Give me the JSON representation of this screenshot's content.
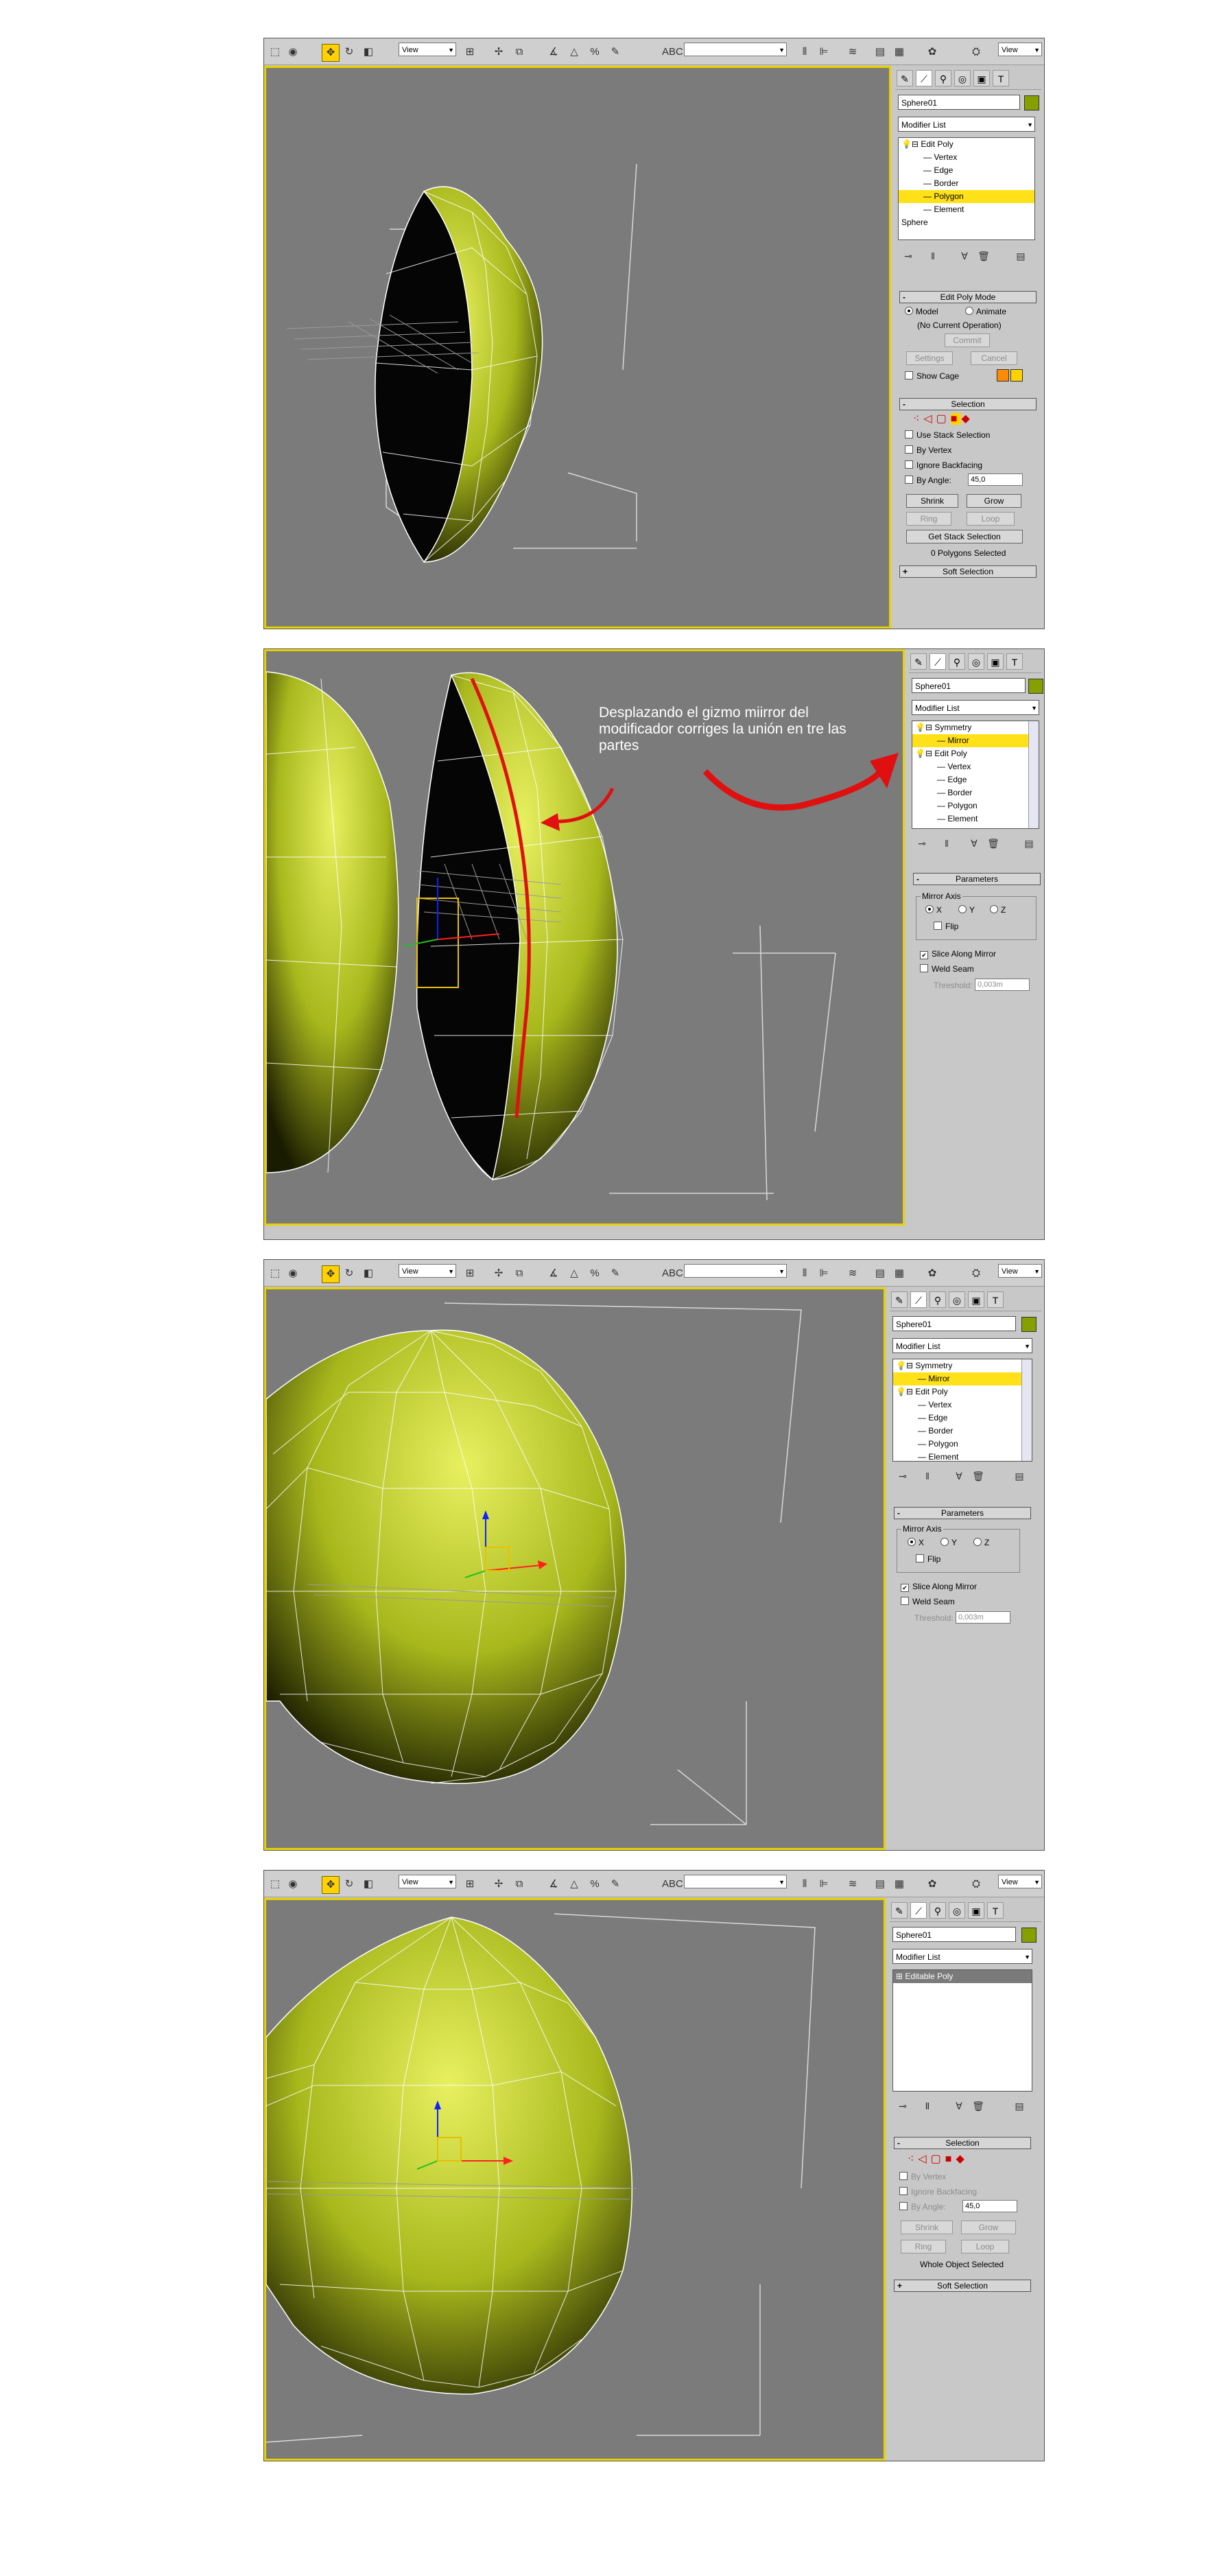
{
  "toolbar": {
    "ref_coord": "View",
    "ref_coord_right": "View",
    "icons": [
      "select-region-icon",
      "select-object-icon",
      "move-icon",
      "rotate-icon",
      "scale-icon",
      "manipulate-icon",
      "snap-icon",
      "angle-snap-icon",
      "percent-snap-icon",
      "spinner-snap-icon",
      "named-selection-icon",
      "mirror-icon",
      "align-icon",
      "layers-icon",
      "curve-editor-icon",
      "schematic-icon",
      "material-editor-icon",
      "render-icon"
    ]
  },
  "panel": {
    "tabs": [
      "create-tab-icon",
      "modify-tab-icon",
      "hierarchy-tab-icon",
      "motion-tab-icon",
      "display-tab-icon",
      "utilities-tab-icon"
    ],
    "object_name": "Sphere01",
    "modifier_list": "Modifier List"
  },
  "shot1": {
    "stack": [
      {
        "label": "Edit Poly",
        "level": 0,
        "icon": "bulb",
        "highlight": false
      },
      {
        "label": "Vertex",
        "level": 1,
        "highlight": false
      },
      {
        "label": "Edge",
        "level": 1,
        "highlight": false
      },
      {
        "label": "Border",
        "level": 1,
        "highlight": false
      },
      {
        "label": "Polygon",
        "level": 1,
        "highlight": true
      },
      {
        "label": "Element",
        "level": 1,
        "highlight": false
      },
      {
        "label": "Sphere",
        "level": 0,
        "icon": "none",
        "highlight": false
      }
    ],
    "edit_poly_mode": {
      "title": "Edit Poly Mode",
      "model": "Model",
      "animate": "Animate",
      "current_op": "(No Current Operation)",
      "commit": "Commit",
      "settings": "Settings",
      "cancel": "Cancel",
      "show_cage": "Show Cage"
    },
    "selection": {
      "title": "Selection",
      "use_stack": "Use Stack Selection",
      "by_vertex": "By Vertex",
      "ignore_backfacing": "Ignore Backfacing",
      "by_angle": "By Angle:",
      "angle_value": "45,0",
      "shrink": "Shrink",
      "grow": "Grow",
      "ring": "Ring",
      "loop": "Loop",
      "get_stack": "Get Stack Selection",
      "status": "0 Polygons Selected"
    },
    "soft_selection": "Soft Selection"
  },
  "shot2": {
    "annotation": "Desplazando el gizmo miirror del modificador corriges la unión en tre las partes",
    "stack": [
      {
        "label": "Symmetry",
        "level": 0,
        "icon": "bulb",
        "highlight": false
      },
      {
        "label": "Mirror",
        "level": 1,
        "highlight": true
      },
      {
        "label": "Edit Poly",
        "level": 0,
        "icon": "bulb",
        "highlight": false
      },
      {
        "label": "Vertex",
        "level": 1,
        "highlight": false
      },
      {
        "label": "Edge",
        "level": 1,
        "highlight": false
      },
      {
        "label": "Border",
        "level": 1,
        "highlight": false
      },
      {
        "label": "Polygon",
        "level": 1,
        "highlight": false
      },
      {
        "label": "Element",
        "level": 1,
        "highlight": false
      }
    ]
  },
  "shot3": {
    "stack": [
      {
        "label": "Symmetry",
        "level": 0,
        "icon": "bulb",
        "highlight": false
      },
      {
        "label": "Mirror",
        "level": 1,
        "highlight": true
      },
      {
        "label": "Edit Poly",
        "level": 0,
        "icon": "bulb",
        "highlight": false
      },
      {
        "label": "Vertex",
        "level": 1,
        "highlight": false
      },
      {
        "label": "Edge",
        "level": 1,
        "highlight": false
      },
      {
        "label": "Border",
        "level": 1,
        "highlight": false
      },
      {
        "label": "Polygon",
        "level": 1,
        "highlight": false
      },
      {
        "label": "Element",
        "level": 1,
        "highlight": false
      }
    ]
  },
  "parameters": {
    "title": "Parameters",
    "mirror_axis": "Mirror Axis",
    "x": "X",
    "y": "Y",
    "z": "Z",
    "flip": "Flip",
    "slice_along_mirror": "Slice Along Mirror",
    "weld_seam": "Weld Seam",
    "threshold": "Threshold:",
    "threshold_value": "0,003m"
  },
  "shot4": {
    "stack": [
      {
        "label": "Editable Poly",
        "level": 0,
        "icon": "plus",
        "highlight": false,
        "dark": true
      }
    ],
    "selection": {
      "title": "Selection",
      "by_vertex": "By Vertex",
      "ignore_backfacing": "Ignore Backfacing",
      "by_angle": "By Angle:",
      "angle_value": "45,0",
      "shrink": "Shrink",
      "grow": "Grow",
      "ring": "Ring",
      "loop": "Loop",
      "status": "Whole Object Selected"
    },
    "soft_selection": "Soft Selection"
  },
  "colors": {
    "sphere_light": "#e8f060",
    "sphere_mid": "#a8b81c",
    "sphere_dark": "#1a1c00",
    "viewport_bg": "#7b7b7b",
    "active_border": "#e8d100",
    "annotation_red": "#e01010",
    "highlight": "#ffe11a"
  }
}
